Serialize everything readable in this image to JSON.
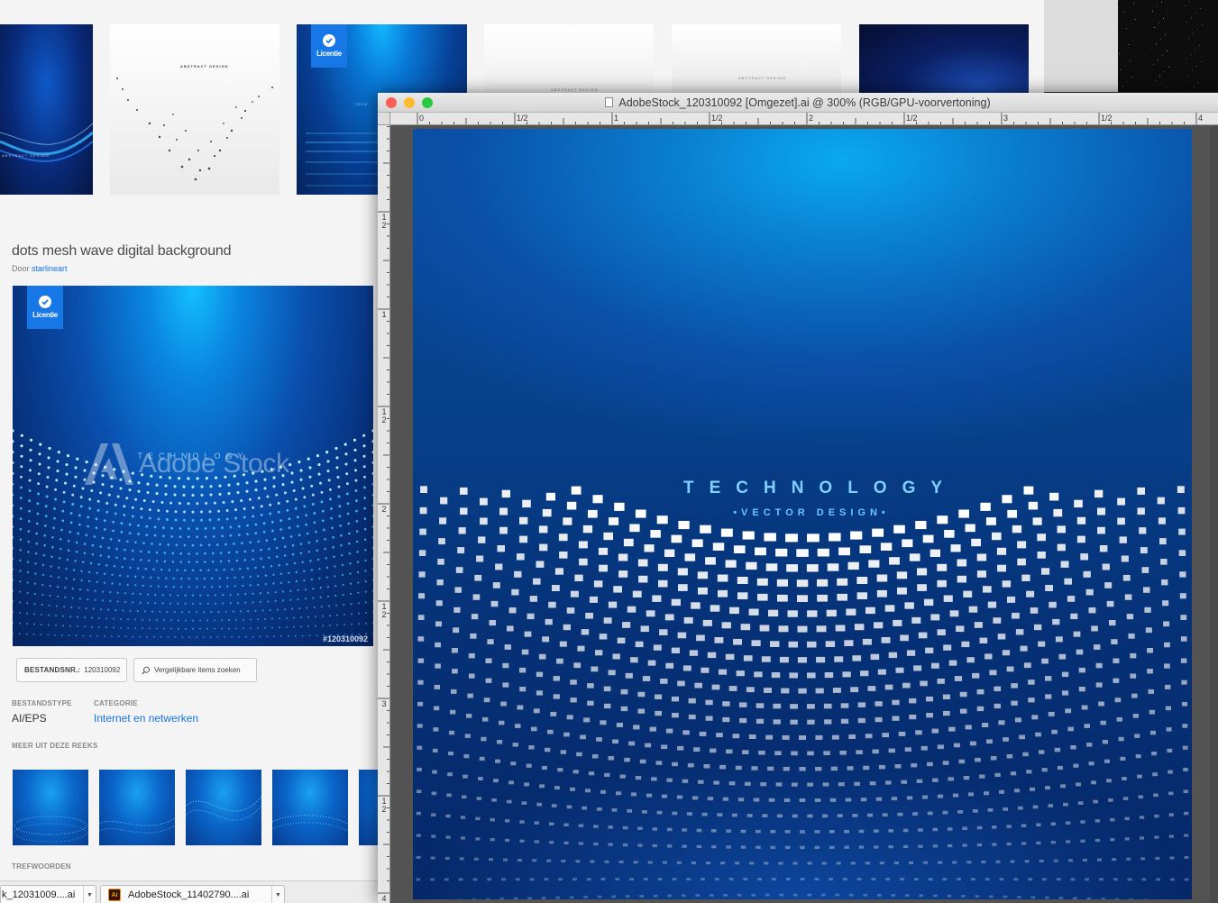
{
  "stock": {
    "thumb_text": {
      "abstract_design": "ABSTRACT DESIGN",
      "abstract_design_small": "ABSTRACT DESIGN",
      "abstract_design_left": "ABSTRACT DESIGN",
      "tech": "TECH"
    },
    "licence_label": "Licentie",
    "asset": {
      "title": "dots mesh wave digital background",
      "author_prefix": "Door",
      "author_name": "starlineart",
      "preview_watermark": "Adobe Stock",
      "preview_tech_text": "TECHNOLOGY",
      "preview_id": "#120310092"
    },
    "file_number_label": "BESTANDSNR.:",
    "file_number_value": "120310092",
    "similar_button": "Vergelijkbare items zoeken",
    "file_type_label": "BESTANDSTYPE",
    "file_type_value": "AI/EPS",
    "category_label": "CATEGORIE",
    "category_value": "Internet en netwerken",
    "series_label": "MEER UIT DEZE REEKS",
    "keywords_label": "TREFWOORDEN",
    "downloads": [
      {
        "name": "k_12031009....ai"
      },
      {
        "name": "AdobeStock_11402790....ai"
      }
    ],
    "ai_icon_label": "Ai"
  },
  "illustrator": {
    "window_title": "AdobeStock_120310092 [Omgezet].ai @ 300% (RGB/GPU-voorvertoning)",
    "ruler_top_labels": [
      "0",
      "1/2",
      "1",
      "1/2",
      "2",
      "1/2",
      "3",
      "1/2",
      "4"
    ],
    "ruler_left_labels": [
      "1\n2",
      "1",
      "1\n2",
      "2",
      "1\n2",
      "3",
      "1\n2",
      "4"
    ],
    "artboard_title": "TECHNOLOGY",
    "artboard_subtitle": "•VECTOR DESIGN•"
  },
  "colors": {
    "traffic_close": "#fd5f57",
    "traffic_minimize": "#fdbc2e",
    "traffic_zoom": "#28c840",
    "licence_badge": "#1777e6",
    "link": "#1473e6"
  }
}
